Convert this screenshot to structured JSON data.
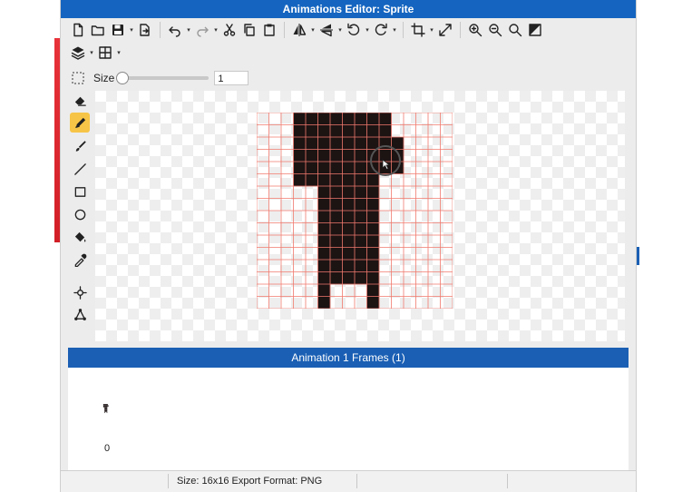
{
  "window": {
    "title": "Animations Editor: Sprite"
  },
  "toolbar_row1": [
    {
      "icon": "new-file-icon"
    },
    {
      "icon": "open-folder-icon"
    },
    {
      "icon": "save-icon",
      "dropdown": true
    },
    {
      "icon": "export-icon"
    },
    {
      "sep": true
    },
    {
      "icon": "undo-icon",
      "dropdown": true
    },
    {
      "icon": "redo-icon",
      "dropdown": true
    },
    {
      "icon": "cut-icon"
    },
    {
      "icon": "copy-icon"
    },
    {
      "icon": "paste-icon"
    },
    {
      "sep": true
    },
    {
      "icon": "flip-horizontal-icon",
      "dropdown": true
    },
    {
      "icon": "flip-vertical-icon",
      "dropdown": true
    },
    {
      "icon": "rotate-left-icon",
      "dropdown": true
    },
    {
      "icon": "rotate-right-icon",
      "dropdown": true
    },
    {
      "sep": true
    },
    {
      "icon": "crop-icon",
      "dropdown": true
    },
    {
      "icon": "resize-icon"
    },
    {
      "sep": true
    },
    {
      "icon": "zoom-in-icon"
    },
    {
      "icon": "zoom-out-icon"
    },
    {
      "icon": "zoom-actual-icon"
    },
    {
      "icon": "background-toggle-icon"
    }
  ],
  "toolbar_row2": [
    {
      "icon": "layers-icon",
      "dropdown": true
    },
    {
      "icon": "grid-icon",
      "dropdown": true
    }
  ],
  "size_control": {
    "label": "Size",
    "value": "1",
    "level": 0.0
  },
  "tools": [
    {
      "icon": "eraser-icon",
      "active": false
    },
    {
      "icon": "pencil-icon",
      "active": true
    },
    {
      "icon": "brush-icon",
      "active": false
    },
    {
      "icon": "line-icon",
      "active": false
    },
    {
      "icon": "rectangle-icon",
      "active": false
    },
    {
      "icon": "ellipse-icon",
      "active": false
    },
    {
      "icon": "fill-bucket-icon",
      "active": false
    },
    {
      "icon": "eyedropper-icon",
      "active": false
    },
    {
      "icon": "move-pivot-icon",
      "active": false
    },
    {
      "icon": "vertex-icon",
      "active": false
    }
  ],
  "sprite": {
    "pixel_color": "#1c1313",
    "grid_color": "#f07a6e",
    "rows": [
      "...########.....",
      "...########.....",
      "...#########....",
      "...#########....",
      "...#########....",
      "...#######......",
      ".....#####......",
      ".....#####......",
      ".....#####......",
      ".....#####......",
      ".....#####......",
      ".....#####......",
      ".....#####......",
      ".....#####......",
      ".....#...#......",
      ".....#...#......"
    ]
  },
  "frames_panel": {
    "title": "Animation 1 Frames (1)",
    "frames": [
      {
        "index": "0"
      }
    ]
  },
  "status": {
    "size_text": "Size: 16x16   Export Format: PNG"
  }
}
